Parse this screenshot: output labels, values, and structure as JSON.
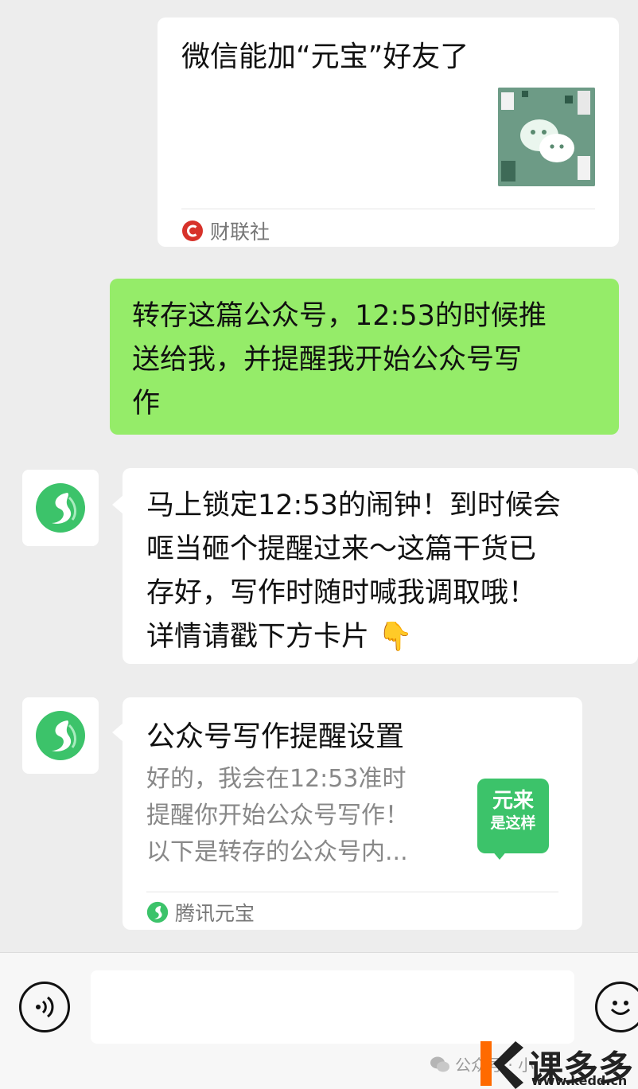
{
  "article_card": {
    "title": "微信能加“元宝”好友了",
    "source": "财联社",
    "thumb_icon": "wechat-logo-icon"
  },
  "user_message": {
    "text": "转存这篇公众号，12:53的时候推\n送给我，并提醒我开始公众号写\n作"
  },
  "bot_message": {
    "text": "马上锁定12:53的闹钟！到时候会\n哐当砸个提醒过来～这篇干货已\n存好，写作时随时喊我调取哦！\n详情请戳下方卡片 👇"
  },
  "reminder_card": {
    "title": "公众号写作提醒设置",
    "desc_lines": [
      "好的，我会在12:53准时",
      "提醒你开始公众号写作！",
      "以下是转存的公众号内..."
    ],
    "thumb_line1": "元来",
    "thumb_line2": "是这样",
    "source": "腾讯元宝"
  },
  "input_bar": {
    "voice_icon": "voice-icon",
    "emoji_icon": "emoji-icon"
  },
  "watermark": {
    "text": "公众号 · 小"
  },
  "brand": {
    "name": "课多多",
    "url": "www.kedd.cn"
  },
  "colors": {
    "user_bubble": "#95ec69",
    "background": "#ededed",
    "yuanbao_green": "#3cc36a",
    "cls_red": "#d7322a"
  }
}
